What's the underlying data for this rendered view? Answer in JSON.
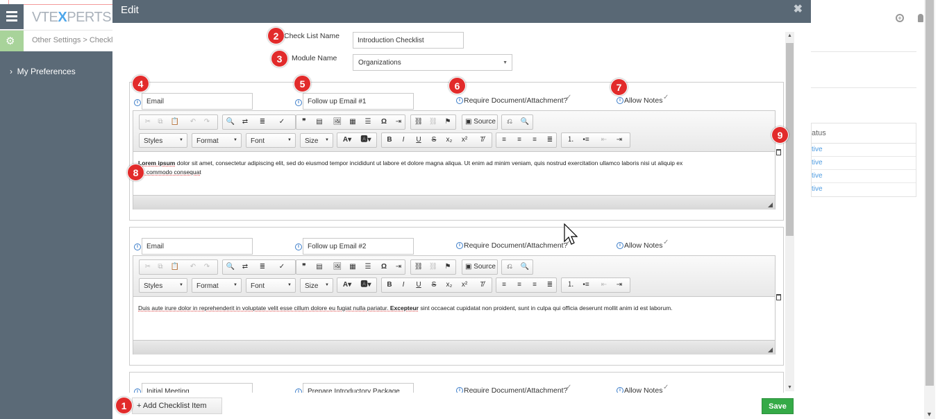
{
  "app": {
    "logo_left": "VTE",
    "logo_x": "X",
    "logo_right": "PERTS",
    "breadcrumb": "Other Settings >  Checklist",
    "left_nav_item": "My Preferences",
    "right_column_header": "atus",
    "right_column_cells": [
      "tive",
      "tive",
      "tive",
      "tive"
    ]
  },
  "modal": {
    "title": "Edit",
    "close_glyph": "✖",
    "checklist_name_label": "Check List Name",
    "checklist_name_value": "Introduction Checklist",
    "module_name_label": "Module Name",
    "module_name_value": "Organizations",
    "add_button_label": "+ Add Checklist Item",
    "save_button_label": "Save"
  },
  "editor_toolbar": {
    "styles": "Styles",
    "format": "Format",
    "font": "Font",
    "size": "Size",
    "source": "Source"
  },
  "items": [
    {
      "type": "Email",
      "title": "Follow up Email #1",
      "require_label": "Require Document/Attachment?",
      "require_checked": true,
      "notes_label": "Allow Notes",
      "notes_checked": true,
      "content_line1_a": "Lorem ipsum",
      "content_line1_b": " dolor sit amet, consectetur adipiscing elit, sed do eiusmod tempor incididunt ut labore et dolore magna aliqua. Ut enim ad minim veniam, quis nostrud exercitation ullamco laboris nisi ut aliquip ex",
      "content_line2": "ea commodo consequat"
    },
    {
      "type": "Email",
      "title": "Follow up Email #2",
      "require_label": "Require Document/Attachment?",
      "require_checked": true,
      "notes_label": "Allow Notes",
      "notes_checked": true,
      "content_a": "Duis aute irure dolor in reprehenderit in voluptate velit esse cillum dolore eu fugiat nulla pariatur. ",
      "content_b": "Excepteur",
      "content_c": " sint occaecat cupidatat non proident, sunt in culpa qui officia deserunt mollit anim id est laborum."
    },
    {
      "type": "Initial Meeting",
      "title": "Prepare Introductory Package",
      "require_label": "Require Document/Attachment?",
      "require_checked": true,
      "notes_label": "Allow Notes",
      "notes_checked": true
    }
  ],
  "badges": [
    "1",
    "2",
    "3",
    "4",
    "5",
    "6",
    "7",
    "8",
    "9"
  ],
  "colors": {
    "header": "#596875",
    "save": "#35aa47",
    "badge": "#e22b2b",
    "info": "#3a7cc9"
  }
}
